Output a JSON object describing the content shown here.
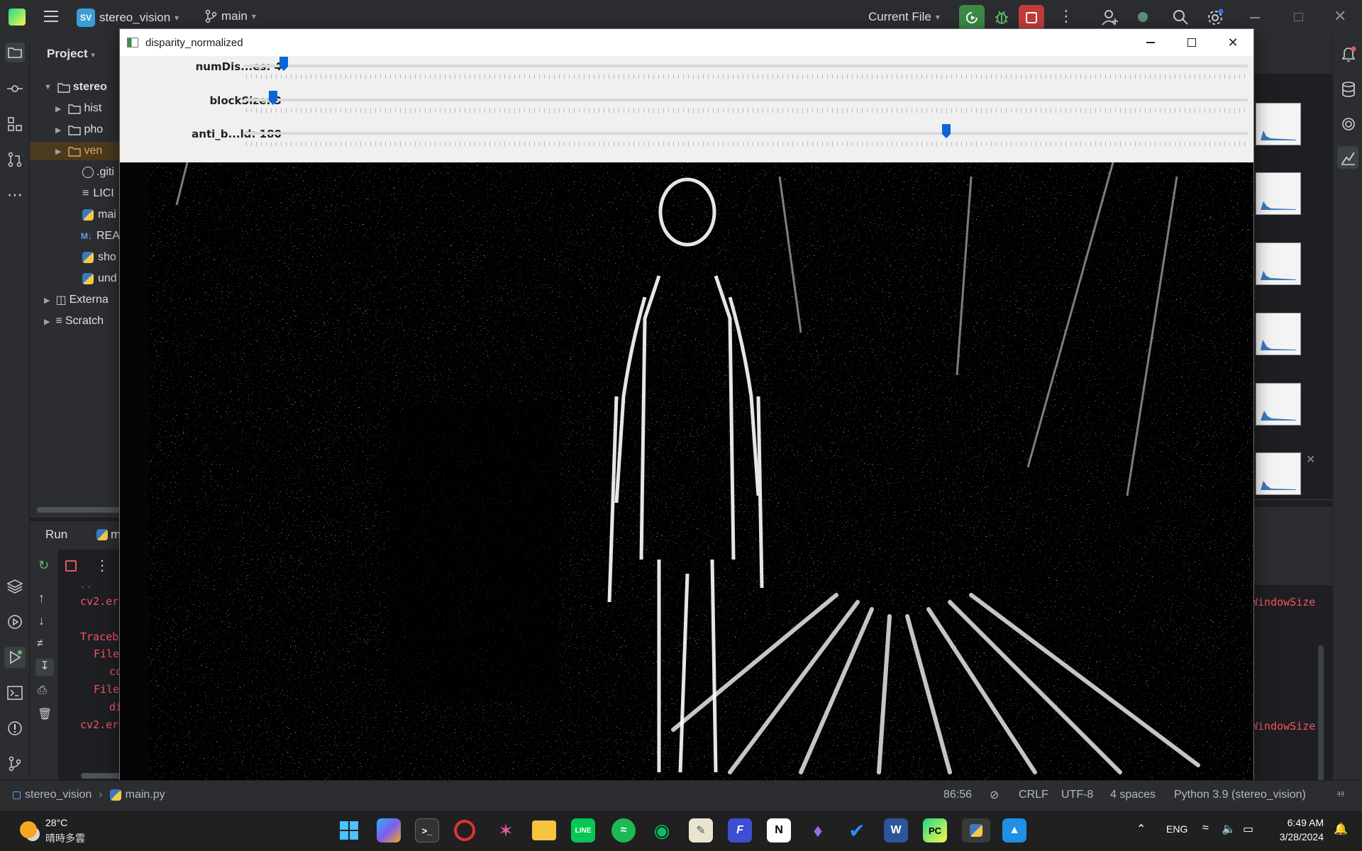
{
  "ide": {
    "project_badge": "SV",
    "project_name": "stereo_vision",
    "branch": "main",
    "run_config": "Current File",
    "project_panel_title": "Project",
    "tree": [
      {
        "label": "stereo",
        "kind": "folder-root"
      },
      {
        "label": "hist",
        "kind": "folder"
      },
      {
        "label": "pho",
        "kind": "folder"
      },
      {
        "label": "ven",
        "kind": "folder-excluded"
      },
      {
        "label": ".giti",
        "kind": "file-ignore"
      },
      {
        "label": "LICI",
        "kind": "file-text"
      },
      {
        "label": "mai",
        "kind": "file-python"
      },
      {
        "label": "REA",
        "kind": "file-markdown"
      },
      {
        "label": "sho",
        "kind": "file-python"
      },
      {
        "label": "und",
        "kind": "file-python"
      },
      {
        "label": "Externa",
        "kind": "libraries"
      },
      {
        "label": "Scratch",
        "kind": "scratches"
      }
    ],
    "run_tab": "Run",
    "run_tab_file": "m",
    "console_lines": [
      "cv2.er",
      "Traceb",
      "File",
      "co",
      "File",
      "di",
      "cv2.er"
    ],
    "console_right": [
      "WindowSize",
      "WindowSize"
    ],
    "colors": {
      "accent": "#3574f0",
      "error_text": "#f75464",
      "run_green": "#3c8a46",
      "stop_red": "#c23c3c"
    }
  },
  "cv_window": {
    "title": "disparity_normalized",
    "trackbars": [
      {
        "label": "numDis...es: 4",
        "position": 0.04
      },
      {
        "label": "blockSize: 3",
        "position": 0.03
      },
      {
        "label": "anti_b...ld: 180",
        "position": 0.7
      }
    ]
  },
  "status": {
    "breadcrumb_project": "stereo_vision",
    "breadcrumb_file": "main.py",
    "cursor": "86:56",
    "line_sep": "CRLF",
    "encoding": "UTF-8",
    "indent": "4 spaces",
    "interpreter": "Python 3.9 (stereo_vision)"
  },
  "taskbar": {
    "weather_temp": "28°C",
    "weather_desc": "晴時多雲",
    "lang": "ENG",
    "time": "6:49 AM",
    "date": "3/28/2024"
  }
}
